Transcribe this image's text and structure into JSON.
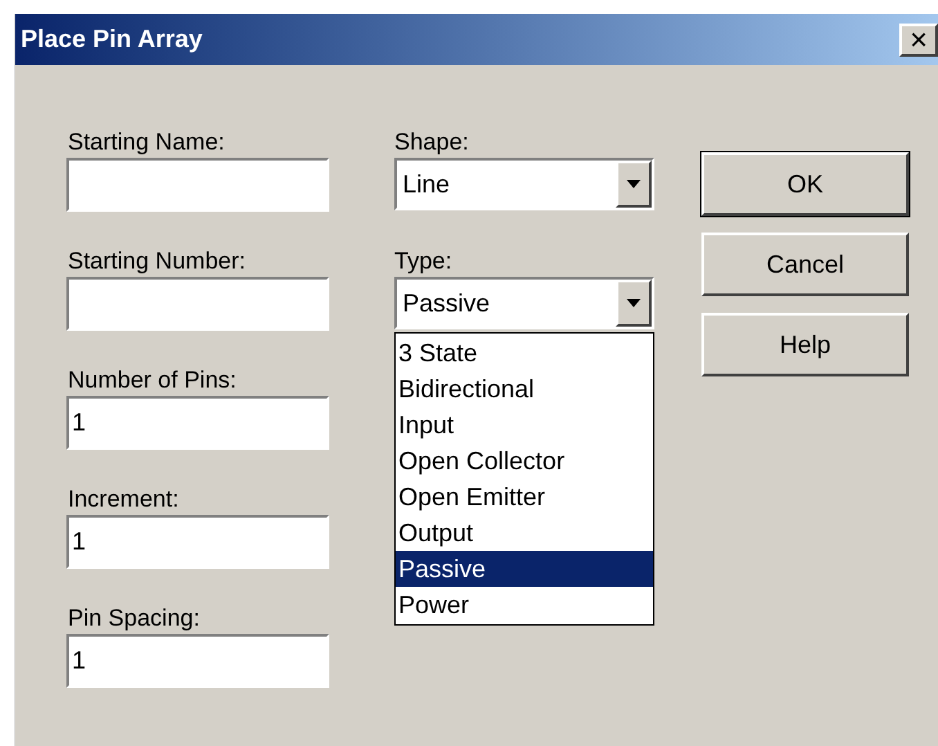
{
  "window": {
    "title": "Place Pin Array",
    "close": "×"
  },
  "fields": [
    {
      "label": "Starting Name:"
    },
    {
      "label": "Starting Number:"
    },
    {
      "label": "Number of Pins:",
      "value": "1"
    },
    {
      "label": "Increment:",
      "value": "1"
    },
    {
      "label": "Pin Spacing:",
      "value": "1"
    }
  ],
  "shape": {
    "label": "Shape:",
    "value": "Line"
  },
  "type": {
    "label": "Type:",
    "value": "Passive",
    "expanded": true,
    "options": [
      {
        "label": "3 State",
        "selected": false
      },
      {
        "label": "Bidirectional",
        "selected": false
      },
      {
        "label": "Input",
        "selected": false
      },
      {
        "label": "Open Collector",
        "selected": false
      },
      {
        "label": "Open Emitter",
        "selected": false
      },
      {
        "label": "Output",
        "selected": false
      },
      {
        "label": "Passive",
        "selected": true
      },
      {
        "label": "Power",
        "selected": false
      }
    ]
  },
  "buttons": [
    "OK",
    "Cancel",
    "Help"
  ]
}
